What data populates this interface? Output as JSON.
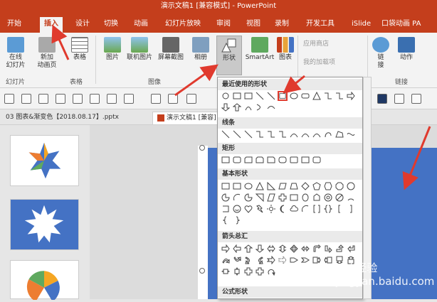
{
  "titlebar": {
    "text": "演示文稿1 [兼容模式] - PowerPoint"
  },
  "tabs": [
    {
      "label": "开始",
      "active": false
    },
    {
      "label": "插入",
      "active": true
    },
    {
      "label": "设计",
      "active": false
    },
    {
      "label": "切换",
      "active": false
    },
    {
      "label": "动画",
      "active": false
    },
    {
      "label": "幻灯片放映",
      "active": false
    },
    {
      "label": "审阅",
      "active": false
    },
    {
      "label": "视图",
      "active": false
    },
    {
      "label": "录制",
      "active": false
    },
    {
      "label": "开发工具",
      "active": false
    },
    {
      "label": "iSlide",
      "active": false
    },
    {
      "label": "口袋动画 PA",
      "active": false
    }
  ],
  "ribbon": {
    "online_slides": "在线\n幻灯片",
    "new_slide": "新加\n动画页",
    "table": "表格",
    "picture": "图片",
    "online_picture": "联机图片",
    "screenshot": "屏幕截图",
    "album": "相册",
    "shapes": "形状",
    "smartart": "SmartArt",
    "chart": "图表",
    "app_store": "应用商店",
    "my_addins": "我的加载项",
    "link": "链\n接",
    "action": "动作",
    "groups": {
      "slides": "幻灯片",
      "tables": "表格",
      "images": "图像",
      "links": "链接"
    }
  },
  "doc_tabs": {
    "tab1": "03 图表&渐变色【2018.08.17】.pptx",
    "tab2": "演示文稿1 [兼容]"
  },
  "shapes_dropdown": {
    "recent": "最近使用的形状",
    "lines": "线条",
    "rectangles": "矩形",
    "basic": "基本形状",
    "arrows": "箭头总汇",
    "equation": "公式形状"
  },
  "watermark": "Bai 经验\njingyan.baidu.com",
  "colors": {
    "accent": "#c43e1c",
    "slide_blue": "#4472c4",
    "arrow_red": "#e03a2e"
  }
}
